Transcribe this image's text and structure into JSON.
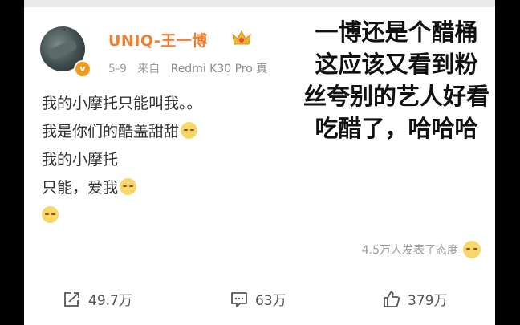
{
  "post": {
    "username": "UNIQ-王一博",
    "date": "5-9",
    "source_prefix": "来自",
    "device": "Redmi K30 Pro 真",
    "lines": [
      "我的小摩托只能叫我。。",
      "我是你们的酷盖甜甜",
      "我的小摩托",
      "只能，爱我"
    ],
    "reactions_text": "4.5万人发表了态度"
  },
  "overlay": {
    "lines": [
      "一博还是个醋桶",
      "这应该又看到粉",
      "丝夸别的艺人好看",
      "吃醋了，哈哈哈"
    ]
  },
  "actions": {
    "repost_count": "49.7万",
    "comment_count": "63万",
    "like_count": "379万"
  },
  "colors": {
    "username": "#f07e2f",
    "badge": "#f39a1e"
  }
}
